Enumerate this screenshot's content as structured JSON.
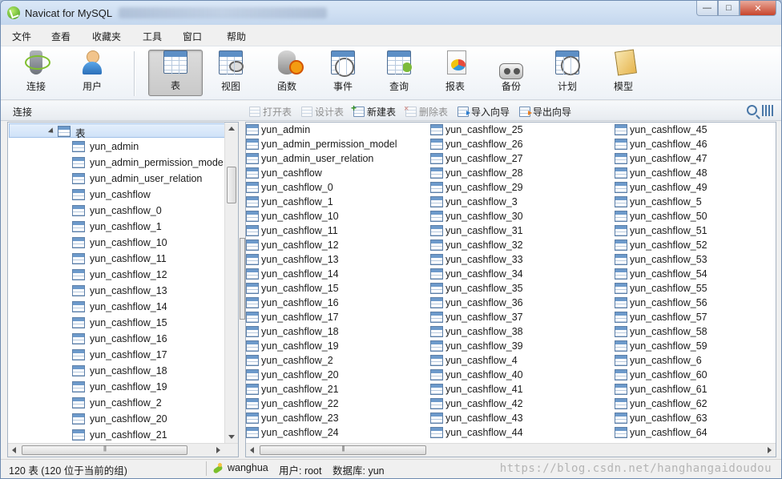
{
  "window": {
    "title": "Navicat for MySQL",
    "min_glyph": "—",
    "max_glyph": "□",
    "close_glyph": "✕"
  },
  "menu": [
    "文件",
    "查看",
    "收藏夹",
    "工具",
    "窗口",
    "帮助"
  ],
  "toolbar": [
    {
      "label": "连接",
      "icon": "plug-icon"
    },
    {
      "label": "用户",
      "icon": "user-icon"
    },
    {
      "label": "表",
      "icon": "table-icon",
      "active": true
    },
    {
      "label": "视图",
      "icon": "view-icon"
    },
    {
      "label": "函数",
      "icon": "function-icon"
    },
    {
      "label": "事件",
      "icon": "event-icon"
    },
    {
      "label": "查询",
      "icon": "query-icon"
    },
    {
      "label": "报表",
      "icon": "report-icon"
    },
    {
      "label": "备份",
      "icon": "backup-icon"
    },
    {
      "label": "计划",
      "icon": "schedule-icon"
    },
    {
      "label": "模型",
      "icon": "model-icon"
    }
  ],
  "subbar": {
    "connection_label": "连接",
    "actions": [
      {
        "label": "打开表",
        "enabled": false
      },
      {
        "label": "设计表",
        "enabled": false
      },
      {
        "label": "新建表",
        "enabled": true
      },
      {
        "label": "删除表",
        "enabled": false
      },
      {
        "label": "导入向导",
        "enabled": true
      },
      {
        "label": "导出向导",
        "enabled": true
      }
    ]
  },
  "tree": {
    "root_label": "表",
    "items": [
      "yun_admin",
      "yun_admin_permission_mode",
      "yun_admin_user_relation",
      "yun_cashflow",
      "yun_cashflow_0",
      "yun_cashflow_1",
      "yun_cashflow_10",
      "yun_cashflow_11",
      "yun_cashflow_12",
      "yun_cashflow_13",
      "yun_cashflow_14",
      "yun_cashflow_15",
      "yun_cashflow_16",
      "yun_cashflow_17",
      "yun_cashflow_18",
      "yun_cashflow_19",
      "yun_cashflow_2",
      "yun_cashflow_20",
      "yun_cashflow_21"
    ]
  },
  "tables": {
    "columns": [
      [
        "yun_admin",
        "yun_admin_permission_model",
        "yun_admin_user_relation",
        "yun_cashflow",
        "yun_cashflow_0",
        "yun_cashflow_1",
        "yun_cashflow_10",
        "yun_cashflow_11",
        "yun_cashflow_12",
        "yun_cashflow_13",
        "yun_cashflow_14",
        "yun_cashflow_15",
        "yun_cashflow_16",
        "yun_cashflow_17",
        "yun_cashflow_18",
        "yun_cashflow_19",
        "yun_cashflow_2",
        "yun_cashflow_20",
        "yun_cashflow_21",
        "yun_cashflow_22",
        "yun_cashflow_23",
        "yun_cashflow_24"
      ],
      [
        "yun_cashflow_25",
        "yun_cashflow_26",
        "yun_cashflow_27",
        "yun_cashflow_28",
        "yun_cashflow_29",
        "yun_cashflow_3",
        "yun_cashflow_30",
        "yun_cashflow_31",
        "yun_cashflow_32",
        "yun_cashflow_33",
        "yun_cashflow_34",
        "yun_cashflow_35",
        "yun_cashflow_36",
        "yun_cashflow_37",
        "yun_cashflow_38",
        "yun_cashflow_39",
        "yun_cashflow_4",
        "yun_cashflow_40",
        "yun_cashflow_41",
        "yun_cashflow_42",
        "yun_cashflow_43",
        "yun_cashflow_44"
      ],
      [
        "yun_cashflow_45",
        "yun_cashflow_46",
        "yun_cashflow_47",
        "yun_cashflow_48",
        "yun_cashflow_49",
        "yun_cashflow_5",
        "yun_cashflow_50",
        "yun_cashflow_51",
        "yun_cashflow_52",
        "yun_cashflow_53",
        "yun_cashflow_54",
        "yun_cashflow_55",
        "yun_cashflow_56",
        "yun_cashflow_57",
        "yun_cashflow_58",
        "yun_cashflow_59",
        "yun_cashflow_6",
        "yun_cashflow_60",
        "yun_cashflow_61",
        "yun_cashflow_62",
        "yun_cashflow_63",
        "yun_cashflow_64"
      ]
    ]
  },
  "status": {
    "count": "120 表 (120 位于当前的组)",
    "connection": "wanghua",
    "user": "用户: root",
    "database": "数据库: yun",
    "watermark": "https://blog.csdn.net/hanghangaidoudou"
  },
  "colors": {
    "title_bar": "#c4d7ee",
    "close_button": "#c7452c",
    "selection": "#cfe2f8"
  }
}
